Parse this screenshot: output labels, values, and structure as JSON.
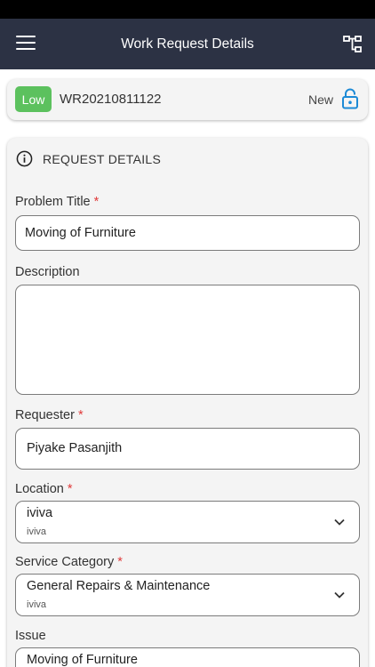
{
  "header": {
    "title": "Work Request Details",
    "menu_icon": "hamburger-menu-icon",
    "hierarchy_icon": "hierarchy-tree-icon",
    "bg_color": "#2c3244"
  },
  "summary": {
    "priority": "Low",
    "priority_color": "#5cc15e",
    "request_number": "WR20210811122",
    "status": "New",
    "lock_icon": "unlock-icon",
    "accent_color": "#1c8ad6"
  },
  "section": {
    "title": "REQUEST DETAILS",
    "icon": "info-icon"
  },
  "form": {
    "required_mark": "*",
    "problem_title": {
      "label": "Problem Title",
      "value": "Moving of Furniture"
    },
    "description": {
      "label": "Description",
      "value": ""
    },
    "requester": {
      "label": "Requester",
      "value": "Piyake Pasanjith"
    },
    "location": {
      "label": "Location",
      "value": "iviva",
      "sub": "iviva"
    },
    "service_category": {
      "label": "Service Category",
      "value": "General Repairs & Maintenance",
      "sub": "iviva"
    },
    "issue": {
      "label": "Issue",
      "value": "Moving of Furniture"
    }
  }
}
